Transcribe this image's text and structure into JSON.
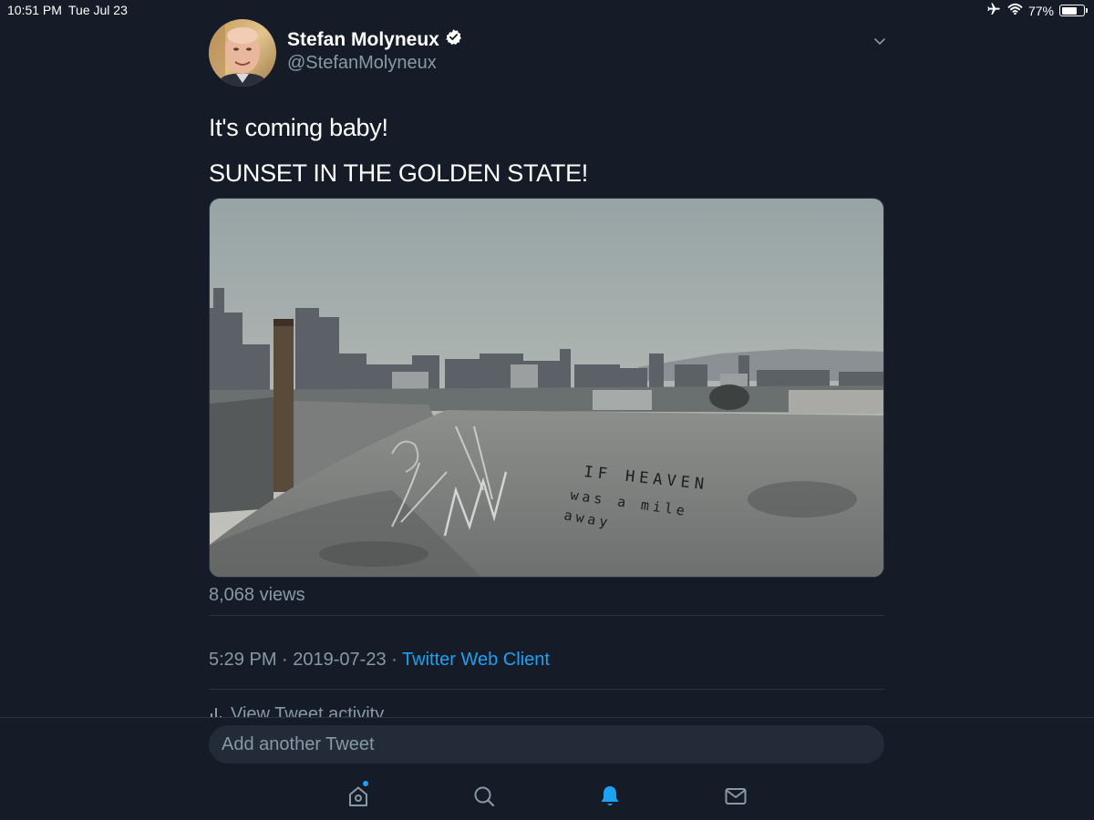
{
  "status_bar": {
    "time": "10:51 PM",
    "date": "Tue Jul 23",
    "battery": "77%",
    "battery_level": 0.77,
    "icons": [
      "airplane-icon",
      "wifi-icon",
      "battery-icon"
    ]
  },
  "tweet": {
    "display_name": "Stefan Molyneux",
    "verified": true,
    "handle": "@StefanMolyneux",
    "lines": [
      "It's coming baby!",
      "SUNSET IN THE GOLDEN STATE!"
    ],
    "media": {
      "type": "video",
      "graffiti_lines": [
        "IF HEAVEN",
        "was   a mile",
        "away"
      ]
    },
    "views": "8,068 views",
    "time": "5:29 PM",
    "separator": "·",
    "date": "2019-07-23",
    "client": "Twitter Web Client",
    "activity": "View Tweet activity"
  },
  "reply": {
    "placeholder": "Add another Tweet"
  },
  "tab_bar": {
    "items": [
      "home-icon",
      "search-icon",
      "notifications-icon",
      "messages-icon"
    ],
    "active": "notifications-icon",
    "home_has_dot": true
  },
  "colors": {
    "background": "#151c28",
    "accent": "#1da1f2",
    "secondary_text": "#8899a6",
    "divider": "#2a3341"
  }
}
